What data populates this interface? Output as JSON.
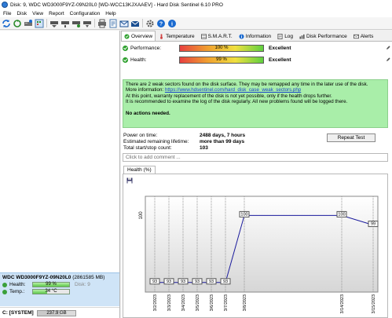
{
  "window": {
    "title": "Disk: 9, WDC WD3000F9YZ-09N20L0 [WD-WCC13KJXAAEV]  -  Hard Disk Sentinel 6.10 PRO"
  },
  "menu": [
    "File",
    "Disk",
    "View",
    "Report",
    "Configuration",
    "Help"
  ],
  "tabs": [
    "Overview",
    "Temperature",
    "S.M.A.R.T.",
    "Information",
    "Log",
    "Disk Performance",
    "Alerts"
  ],
  "overview": {
    "performance": {
      "label": "Performance:",
      "value": 100,
      "text": "100 %",
      "verdict": "Excellent"
    },
    "health": {
      "label": "Health:",
      "value": 99,
      "text": "99 %",
      "verdict": "Excellent"
    },
    "message": {
      "line1": "There are 2 weak sectors found on the disk surface. They may be remapped any time in the later use of the disk.",
      "line2_prefix": "More information: ",
      "link": "https://www.hdsentinel.com/hard_disk_case_weak_sectors.php",
      "line3": "At this point, warranty replacement of the disk is not yet possible, only if the health drops further.",
      "line4": "It is recommended to examine the log of the disk regularly. All new problems found will be logged there.",
      "line5": "No actions needed."
    },
    "stats": [
      {
        "k": "Power on time:",
        "v": "2488 days, 7 hours"
      },
      {
        "k": "Estimated remaining lifetime:",
        "v": "more than 99 days"
      },
      {
        "k": "Total start/stop count:",
        "v": "103"
      }
    ],
    "repeat_label": "Repeat Test",
    "comment_placeholder": "Click to add comment ..."
  },
  "health_tab": "Health (%)",
  "chart_data": {
    "type": "line",
    "x": [
      "3/2/2023",
      "3/3/2023",
      "3/4/2023",
      "3/5/2023",
      "3/6/2023",
      "3/7/2023",
      "3/8/2023",
      "3/14/2023",
      "3/15/2023"
    ],
    "values": [
      93,
      93,
      93,
      93,
      93,
      93,
      100,
      100,
      99
    ],
    "ylabel": "100",
    "color": "#1a1a9c"
  },
  "disk": {
    "name": "WDC WD3000F9YZ-09N20L0",
    "size": "(2861585 MB)",
    "health_label": "Health:",
    "health_text": "99 %",
    "health_value": 99,
    "disk_label": "Disk: 9",
    "temp_label": "Temp.:",
    "temp_text": "34 °C",
    "temp_value": 40
  },
  "volume": {
    "name": "C: [SYSTEM]",
    "size": "237.9 GB"
  }
}
